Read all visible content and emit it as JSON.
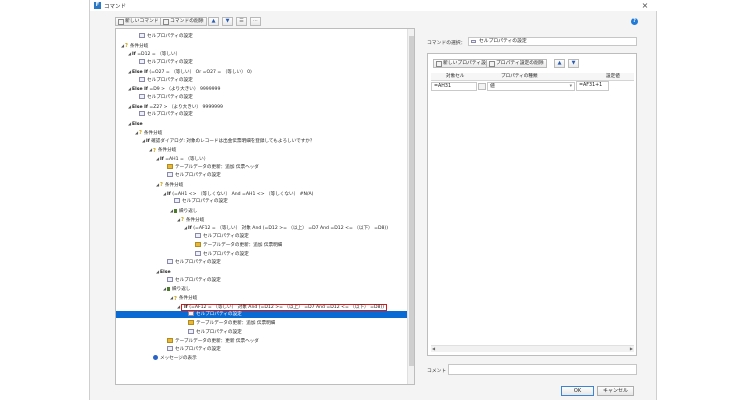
{
  "window": {
    "title": "コマンド",
    "close": "×",
    "help": "?"
  },
  "toolbar": {
    "new_command": "新しいコマンド",
    "delete_command": "コマンドの削除",
    "move_up": "▲",
    "move_down": "▼",
    "align": "☰",
    "more": "⋯"
  },
  "tree": {
    "rows": [
      {
        "indent": 2,
        "tw": "",
        "icon": "prop",
        "kw": "",
        "text": "セルプロパティの設定"
      },
      {
        "indent": 0,
        "tw": "◢",
        "icon": "q",
        "kw": "",
        "text": "条件分岐"
      },
      {
        "indent": 1,
        "tw": "◢",
        "icon": "",
        "kw": "If",
        "text": "=D12 = （等しい）"
      },
      {
        "indent": 2,
        "tw": "",
        "icon": "prop",
        "kw": "",
        "text": "セルプロパティの設定"
      },
      {
        "indent": 1,
        "tw": "◢",
        "icon": "",
        "kw": "Else If",
        "text": "(=O27 = （等しい） Or =O27 = （等しい） 0)"
      },
      {
        "indent": 2,
        "tw": "",
        "icon": "prop",
        "kw": "",
        "text": "セルプロパティの設定"
      },
      {
        "indent": 1,
        "tw": "◢",
        "icon": "",
        "kw": "Else If",
        "text": "=D9 > （より大きい） 9999999"
      },
      {
        "indent": 2,
        "tw": "",
        "icon": "prop",
        "kw": "",
        "text": "セルプロパティの設定"
      },
      {
        "indent": 1,
        "tw": "◢",
        "icon": "",
        "kw": "Else If",
        "text": "=Z27 > （より大きい） 9999999"
      },
      {
        "indent": 2,
        "tw": "",
        "icon": "prop",
        "kw": "",
        "text": "セルプロパティの設定"
      },
      {
        "indent": 1,
        "tw": "◢",
        "icon": "",
        "kw": "Else",
        "text": ""
      },
      {
        "indent": 2,
        "tw": "◢",
        "icon": "q",
        "kw": "",
        "text": "条件分岐"
      },
      {
        "indent": 3,
        "tw": "◢",
        "icon": "",
        "kw": "If",
        "text": "確認ダイアログ: 対象のレコードは出金伝票明細を登録してもよろしいですか？"
      },
      {
        "indent": 4,
        "tw": "◢",
        "icon": "q",
        "kw": "",
        "text": "条件分岐"
      },
      {
        "indent": 5,
        "tw": "◢",
        "icon": "",
        "kw": "If",
        "text": "=AH1 = （等しい）"
      },
      {
        "indent": 6,
        "tw": "",
        "icon": "table",
        "kw": "",
        "text": "テーブルデータの更新：追加 伝票ヘッダ"
      },
      {
        "indent": 6,
        "tw": "",
        "icon": "prop",
        "kw": "",
        "text": "セルプロパティの設定"
      },
      {
        "indent": 5,
        "tw": "◢",
        "icon": "q",
        "kw": "",
        "text": "条件分岐"
      },
      {
        "indent": 6,
        "tw": "◢",
        "icon": "",
        "kw": "If",
        "text": "(=AH1 <> （等しくない） And =AH1 <> （等しくない） #N/A)"
      },
      {
        "indent": 7,
        "tw": "",
        "icon": "prop",
        "kw": "",
        "text": "セルプロパティの設定"
      },
      {
        "indent": 7,
        "tw": "◢",
        "icon": "loop",
        "kw": "",
        "text": "繰り返し"
      },
      {
        "indent": 8,
        "tw": "◢",
        "icon": "q",
        "kw": "",
        "text": "条件分岐"
      },
      {
        "indent": 9,
        "tw": "◢",
        "icon": "",
        "kw": "If",
        "text": "(=AF12 = （等しい） 対象 And (=D12 >= （以上） =D7 And =D12 <= （以下） =D8))"
      },
      {
        "indent": 10,
        "tw": "",
        "icon": "prop",
        "kw": "",
        "text": "セルプロパティの設定"
      },
      {
        "indent": 10,
        "tw": "",
        "icon": "table",
        "kw": "",
        "text": "テーブルデータの更新：追加 伝票明細"
      },
      {
        "indent": 10,
        "tw": "",
        "icon": "prop",
        "kw": "",
        "text": "セルプロパティの設定"
      },
      {
        "indent": 6,
        "tw": "",
        "icon": "prop",
        "kw": "",
        "text": "セルプロパティの設定"
      },
      {
        "indent": 5,
        "tw": "◢",
        "icon": "",
        "kw": "Else",
        "text": ""
      },
      {
        "indent": 6,
        "tw": "",
        "icon": "prop",
        "kw": "",
        "text": "セルプロパティの設定"
      },
      {
        "indent": 6,
        "tw": "◢",
        "icon": "loop",
        "kw": "",
        "text": "繰り返し"
      },
      {
        "indent": 7,
        "tw": "◢",
        "icon": "q",
        "kw": "",
        "text": "条件分岐"
      },
      {
        "indent": 8,
        "tw": "◢",
        "icon": "",
        "kw": "If",
        "text": "(=AF12 = （等しい） 対象 And (=D12 >= （以上） =D7 And =D12 <= （以下） =D8))",
        "highlight": true
      },
      {
        "indent": 9,
        "tw": "",
        "icon": "prop",
        "kw": "",
        "text": "セルプロパティの設定",
        "selected": true
      },
      {
        "indent": 9,
        "tw": "",
        "icon": "table",
        "kw": "",
        "text": "テーブルデータの更新：追加 伝票明細"
      },
      {
        "indent": 9,
        "tw": "",
        "icon": "prop",
        "kw": "",
        "text": "セルプロパティの設定"
      },
      {
        "indent": 6,
        "tw": "",
        "icon": "table",
        "kw": "",
        "text": "テーブルデータの更新：更新 伝票ヘッダ"
      },
      {
        "indent": 6,
        "tw": "",
        "icon": "prop",
        "kw": "",
        "text": "セルプロパティの設定"
      },
      {
        "indent": 4,
        "tw": "",
        "icon": "info",
        "kw": "",
        "text": "メッセージの表示"
      }
    ]
  },
  "right": {
    "command_select_label": "コマンドの選択：",
    "command_select_value": "セルプロパティの設定",
    "new_property_button": "新しいプロパティ設定",
    "delete_property_button": "プロパティ設定の削除",
    "move_up": "▲",
    "move_down": "▼",
    "headers": {
      "target_cell": "対象セル",
      "property_type": "プロパティの種類",
      "value": "設定値"
    },
    "row": {
      "target_cell": "=AH31",
      "property_type": "値",
      "value": "=AF31+1"
    },
    "comment_label": "コメント",
    "comment_value": ""
  },
  "footer": {
    "ok": "OK",
    "cancel": "キャンセル"
  },
  "colors": {
    "selection": "#0a6ad4",
    "highlight_border": "#d11b1b",
    "accent": "#1f7ad8"
  }
}
